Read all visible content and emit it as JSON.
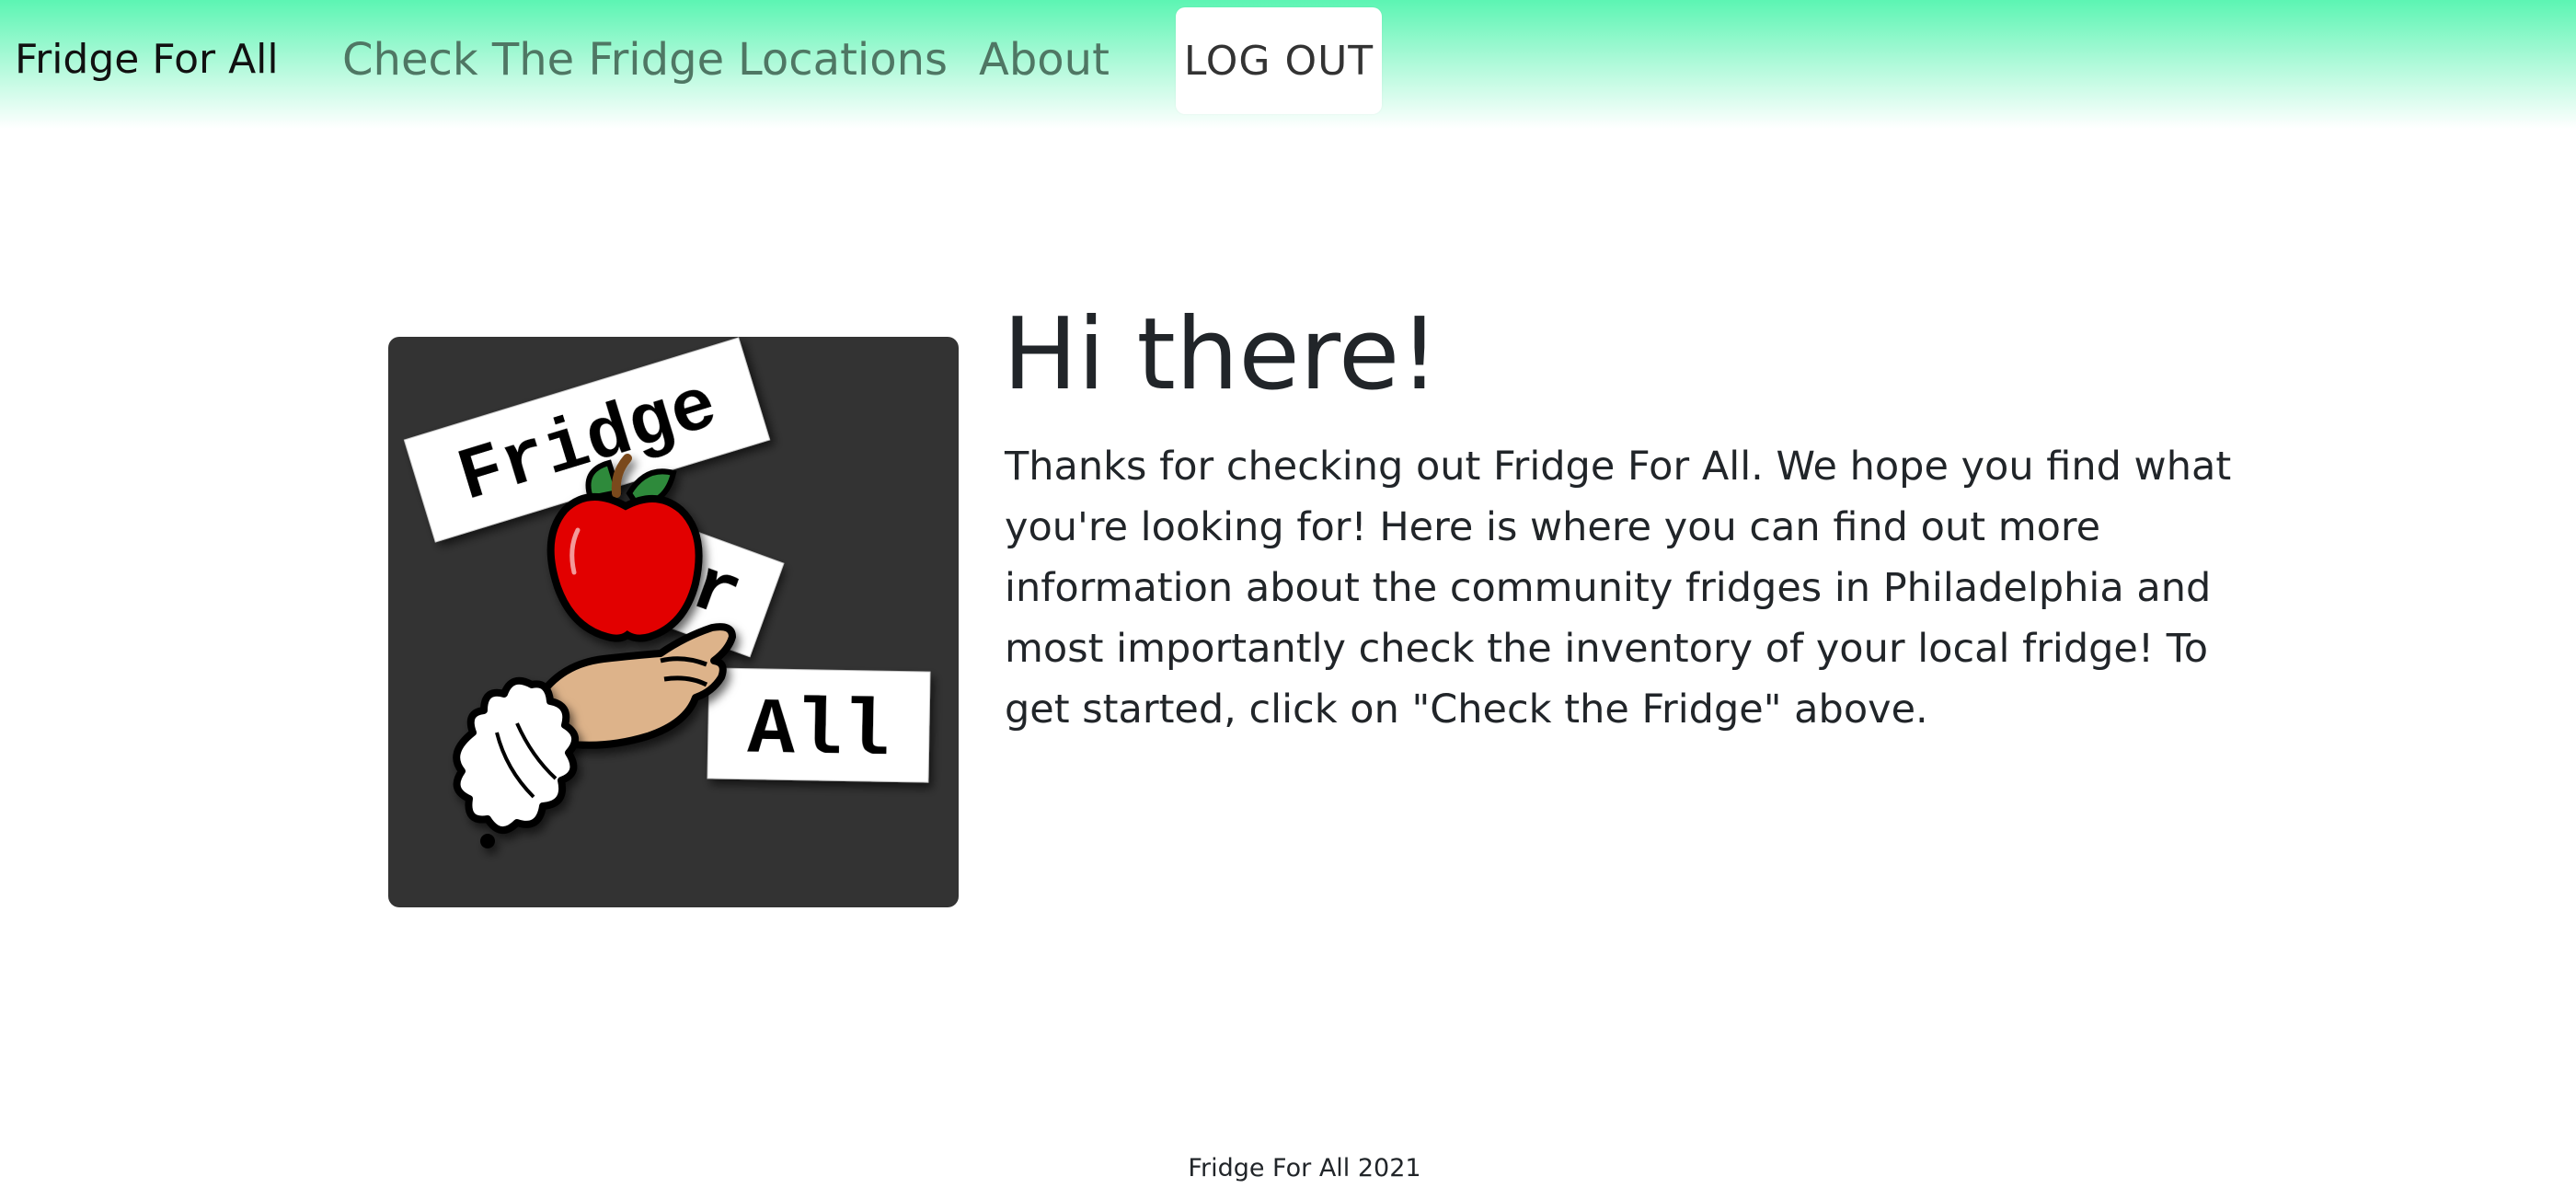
{
  "navbar": {
    "brand": "Fridge For All",
    "links": [
      "Check The Fridge",
      "Locations",
      "About"
    ],
    "logout_label": "LOG OUT",
    "gradient_top": "#5cf5b3",
    "gradient_bottom": "#ffffff"
  },
  "logo": {
    "words": [
      "Fridge",
      "for",
      "All"
    ],
    "background": "#333333",
    "apple_color": "#e20000"
  },
  "main": {
    "heading": "Hi there!",
    "intro": "Thanks for checking out Fridge For All. We hope you find what you're looking for! Here is where you can find out more information about the community fridges in Philadelphia and most importantly check the inventory of your local fridge! To get started, click on \"Check the Fridge\" above."
  },
  "footer": {
    "text": "Fridge For All 2021"
  }
}
